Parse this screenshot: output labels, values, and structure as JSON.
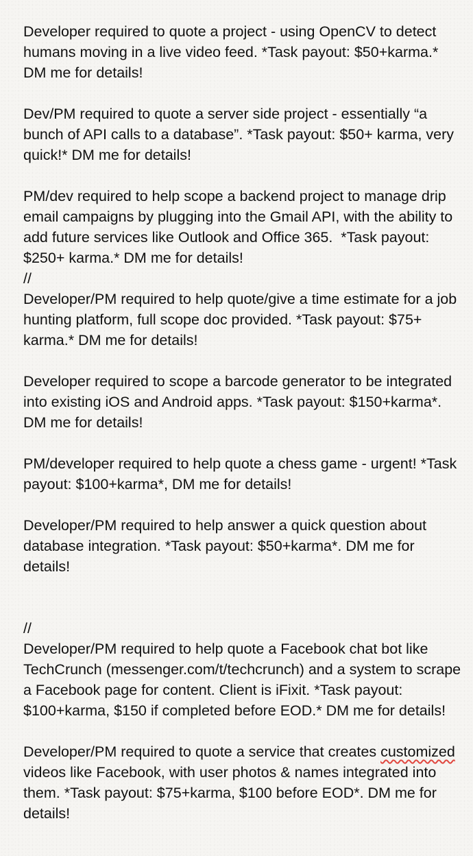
{
  "posts": {
    "p1": "Developer required to quote a project - using OpenCV to detect humans moving in a live video feed. *Task payout: $50+karma.* DM me for details!",
    "p2": "Dev/PM required to quote a server side project - essentially “a bunch of API calls to a database”. *Task payout: $50+ karma, very quick!* DM me for details!",
    "p3": "PM/dev required to help scope a backend project to manage drip email campaigns by plugging into the Gmail API, with the ability to add future services like Outlook and Office 365.  *Task payout: $250+ karma.* DM me for details!",
    "sep1": "//",
    "p4": "Developer/PM required to help quote/give a time estimate for a job hunting platform, full scope doc provided. *Task payout: $75+ karma.* DM me for details!",
    "p5": "Developer required to scope a barcode generator to be integrated into existing iOS and Android apps. *Task payout: $150+karma*. DM me for details!",
    "p6": "PM/developer required to help quote a chess game - urgent! *Task payout: $100+karma*, DM me for details!",
    "p7": "Developer/PM required to help answer a quick question about database integration. *Task payout: $50+karma*. DM me for details!",
    "sep2": "//",
    "p8": "Developer/PM required to help quote a Facebook chat bot like TechCrunch (messenger.com/t/techcrunch) and a system to scrape a Facebook page for content. Client is iFixit. *Task payout: $100+karma, $150 if completed before EOD.* DM me for details!",
    "p9_before": "Developer/PM required to quote a service that creates ",
    "p9_misspelled": "customized",
    "p9_after": " videos like Facebook, with user photos & names integrated into them. *Task payout: $75+karma, $100 before EOD*. DM me for details!"
  },
  "colors": {
    "background": "#f6f5f2",
    "text": "#111111",
    "spellcheck_underline": "#e0463e"
  }
}
